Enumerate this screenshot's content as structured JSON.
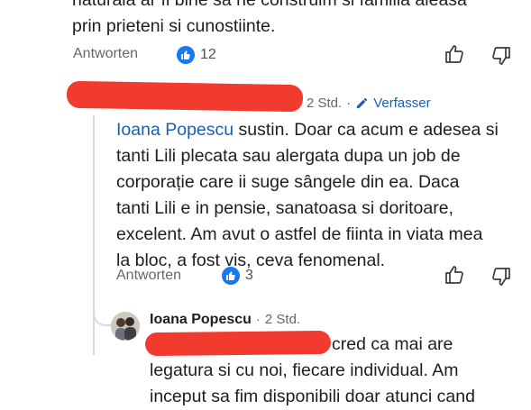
{
  "top_comment": {
    "lines": [
      "naturala ar fi bine sa ne construim si familia aleasa",
      "prin prieteni si cunostiinte."
    ],
    "reply_label": "Antworten",
    "likes": "12"
  },
  "reply1": {
    "time": "2 Std.",
    "dot": "·",
    "edit_label": "Verfasser",
    "mention": "Ioana Popescu",
    "lines": [
      " sustin. Doar ca acum e adesea si",
      "tanti Lili plecata sau alergata dupa un job de",
      "corporație care ii suge sângele din ea. Daca",
      "tanti Lili e in pensie, sanatoasa si doritoare,",
      "excelent. Am avut o astfel de fiinta in viata mea",
      "la bloc, a fost vis, ceva fenomenal."
    ],
    "reply_label": "Antworten",
    "likes": "3"
  },
  "reply2": {
    "author": "Ioana Popescu",
    "dot": "·",
    "time": "2 Std.",
    "lines": [
      "cred ca mai are",
      "legatura si cu noi, fiecare individual. Am",
      "inceput sa fim disponibili doar atunci cand"
    ]
  },
  "colors": {
    "link_blue": "#1a5fb4",
    "like_blue": "#1877f2",
    "redaction_red": "#f13b2f",
    "meta_gray": "#65676b"
  }
}
